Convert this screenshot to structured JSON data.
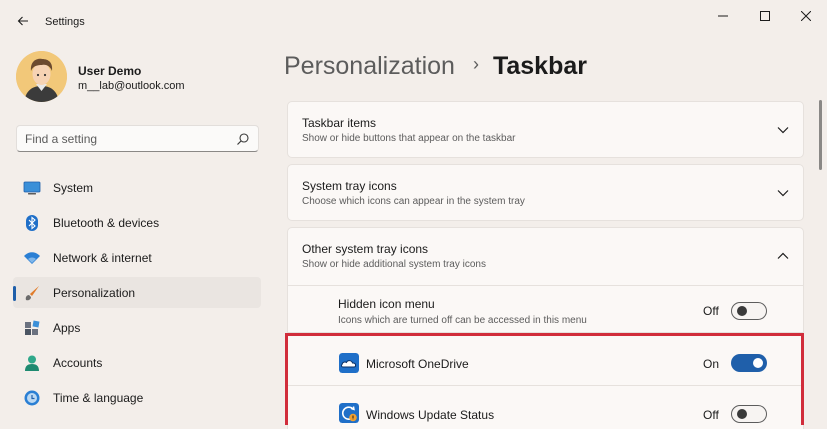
{
  "window": {
    "title": "Settings",
    "controls": [
      "minimize",
      "maximize",
      "close"
    ]
  },
  "user": {
    "name": "User Demo",
    "email": "m__lab@outlook.com"
  },
  "search": {
    "placeholder": "Find a setting"
  },
  "nav": [
    {
      "label": "System",
      "icon": "monitor-icon"
    },
    {
      "label": "Bluetooth & devices",
      "icon": "bluetooth-icon"
    },
    {
      "label": "Network & internet",
      "icon": "wifi-icon"
    },
    {
      "label": "Personalization",
      "icon": "paintbrush-icon",
      "active": true
    },
    {
      "label": "Apps",
      "icon": "apps-icon"
    },
    {
      "label": "Accounts",
      "icon": "person-icon"
    },
    {
      "label": "Time & language",
      "icon": "globe-clock-icon"
    }
  ],
  "breadcrumb": {
    "parent": "Personalization",
    "separator": "›",
    "current": "Taskbar"
  },
  "sections": [
    {
      "title": "Taskbar items",
      "description": "Show or hide buttons that appear on the taskbar",
      "expanded": false
    },
    {
      "title": "System tray icons",
      "description": "Choose which icons can appear in the system tray",
      "expanded": false
    },
    {
      "title": "Other system tray icons",
      "description": "Show or hide additional system tray icons",
      "expanded": true
    }
  ],
  "hidden_icon_menu": {
    "title": "Hidden icon menu",
    "description": "Icons which are turned off can be accessed in this menu",
    "state": "Off"
  },
  "tray_apps": [
    {
      "name": "Microsoft OneDrive",
      "state": "On",
      "icon": "onedrive-icon"
    },
    {
      "name": "Windows Update Status",
      "state": "Off",
      "icon": "windows-update-icon"
    }
  ],
  "colors": {
    "accent": "#1f5faa",
    "highlight_border": "#d12d3b",
    "background": "#f3eeea"
  }
}
